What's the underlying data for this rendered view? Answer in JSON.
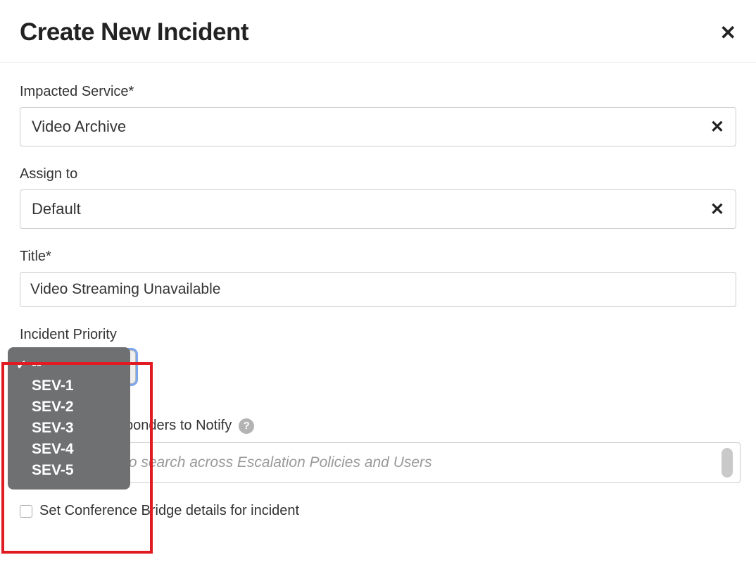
{
  "modal": {
    "title": "Create New Incident"
  },
  "fields": {
    "impacted_service": {
      "label": "Impacted Service*",
      "value": "Video Archive"
    },
    "assign_to": {
      "label": "Assign to",
      "value": "Default"
    },
    "title": {
      "label": "Title*",
      "value": "Video Streaming Unavailable"
    },
    "priority": {
      "label": "Incident Priority",
      "options": [
        "--",
        "SEV-1",
        "SEV-2",
        "SEV-3",
        "SEV-4",
        "SEV-5"
      ],
      "selected": "--"
    },
    "responders": {
      "label": "sponders to Notify",
      "placeholder": "to search across Escalation Policies and Users"
    },
    "conference": {
      "label": "Set Conference Bridge details for incident"
    }
  }
}
